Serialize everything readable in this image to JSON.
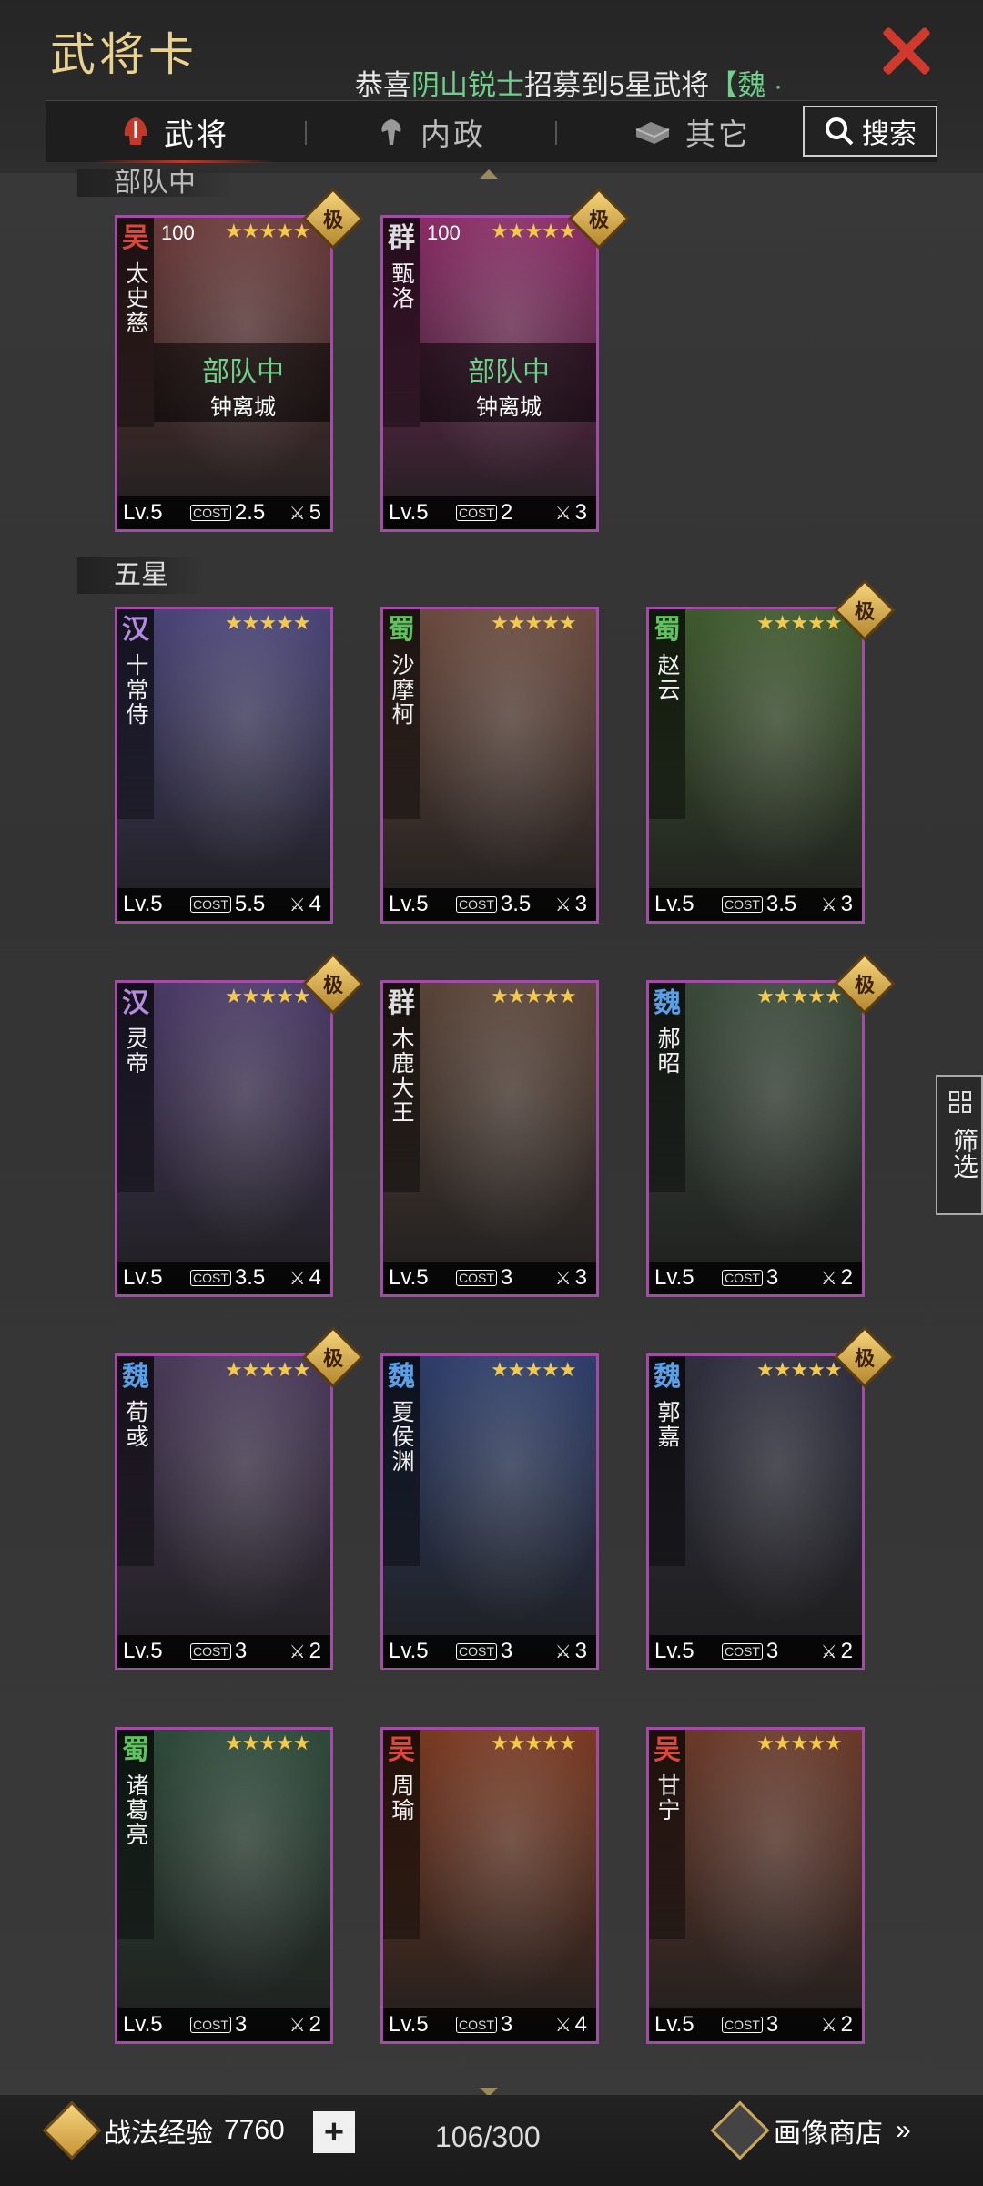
{
  "header": {
    "title": "武将卡",
    "close_icon": "close-x-icon"
  },
  "ticker": {
    "prefix": "恭喜",
    "name": "阴山锐士",
    "middle": "招募到5星武将",
    "suffix": "【魏 ·"
  },
  "tabs": [
    {
      "label": "武将",
      "icon": "helmet-icon",
      "active": true
    },
    {
      "label": "内政",
      "icon": "tree-icon",
      "active": false
    },
    {
      "label": "其它",
      "icon": "ingot-icon",
      "active": false
    }
  ],
  "search": {
    "label": "搜索",
    "icon": "search-icon"
  },
  "sections": {
    "deployed_partial": "部队中",
    "five_star": "五星"
  },
  "deployed": [
    {
      "faction": "吴",
      "faction_color": "#e0463a",
      "name": "太史慈",
      "cost_top": "100",
      "stars": "★★★★★",
      "extreme": "极",
      "status": "部队中",
      "city": "钟离城",
      "level": "Lv.5",
      "cost": "2.5",
      "arms": "5",
      "bg": "#6b3a3a"
    },
    {
      "faction": "群",
      "faction_color": "#dddddd",
      "name": "甄洛",
      "cost_top": "100",
      "stars": "★★★★★",
      "extreme": "极",
      "status": "部队中",
      "city": "钟离城",
      "level": "Lv.5",
      "cost": "2",
      "arms": "3",
      "bg": "#8a2d66"
    }
  ],
  "five_star": [
    {
      "faction": "汉",
      "faction_color": "#b38ce0",
      "name": "十常侍",
      "stars": "★★★★★",
      "extreme": "",
      "level": "Lv.5",
      "cost": "5.5",
      "arms": "4",
      "bg": "#4a4477"
    },
    {
      "faction": "蜀",
      "faction_color": "#5fc25f",
      "name": "沙摩柯",
      "stars": "★★★★★",
      "extreme": "",
      "level": "Lv.5",
      "cost": "3.5",
      "arms": "3",
      "bg": "#6a4a3e"
    },
    {
      "faction": "蜀",
      "faction_color": "#5fc25f",
      "name": "赵云",
      "stars": "★★★★★",
      "extreme": "极",
      "level": "Lv.5",
      "cost": "3.5",
      "arms": "3",
      "bg": "#3f5a2e"
    },
    {
      "faction": "汉",
      "faction_color": "#b38ce0",
      "name": "灵帝",
      "stars": "★★★★★",
      "extreme": "极",
      "level": "Lv.5",
      "cost": "3.5",
      "arms": "4",
      "bg": "#4a3a66"
    },
    {
      "faction": "群",
      "faction_color": "#dddddd",
      "name": "木鹿大王",
      "stars": "★★★★★",
      "extreme": "",
      "level": "Lv.5",
      "cost": "3",
      "arms": "3",
      "bg": "#5a4438"
    },
    {
      "faction": "魏",
      "faction_color": "#5aa0e8",
      "name": "郝昭",
      "stars": "★★★★★",
      "extreme": "极",
      "level": "Lv.5",
      "cost": "3",
      "arms": "2",
      "bg": "#3a4a3a"
    },
    {
      "faction": "魏",
      "faction_color": "#5aa0e8",
      "name": "荀彧",
      "stars": "★★★★★",
      "extreme": "极",
      "level": "Lv.5",
      "cost": "3",
      "arms": "2",
      "bg": "#4a3a5a"
    },
    {
      "faction": "魏",
      "faction_color": "#5aa0e8",
      "name": "夏侯渊",
      "stars": "★★★★★",
      "extreme": "",
      "level": "Lv.5",
      "cost": "3",
      "arms": "3",
      "bg": "#2e3e6a"
    },
    {
      "faction": "魏",
      "faction_color": "#5aa0e8",
      "name": "郭嘉",
      "stars": "★★★★★",
      "extreme": "极",
      "level": "Lv.5",
      "cost": "3",
      "arms": "2",
      "bg": "#2e2e3e"
    },
    {
      "faction": "蜀",
      "faction_color": "#5fc25f",
      "name": "诸葛亮",
      "stars": "★★★★★",
      "extreme": "",
      "level": "Lv.5",
      "cost": "3",
      "arms": "2",
      "bg": "#2e4a3a"
    },
    {
      "faction": "吴",
      "faction_color": "#e0463a",
      "name": "周瑜",
      "stars": "★★★★★",
      "extreme": "",
      "level": "Lv.5",
      "cost": "3",
      "arms": "4",
      "bg": "#7a3a22"
    },
    {
      "faction": "吴",
      "faction_color": "#e0463a",
      "name": "甘宁",
      "stars": "★★★★★",
      "extreme": "",
      "level": "Lv.5",
      "cost": "3",
      "arms": "2",
      "bg": "#6a3a2a"
    }
  ],
  "filter": {
    "label": "筛选",
    "icon": "grid-icon"
  },
  "footer": {
    "exp_label": "战法经验",
    "exp_value": "7760",
    "plus_icon": "plus-icon",
    "count": "106/300",
    "shop_label": "画像商店",
    "shop_arrow": "»"
  }
}
